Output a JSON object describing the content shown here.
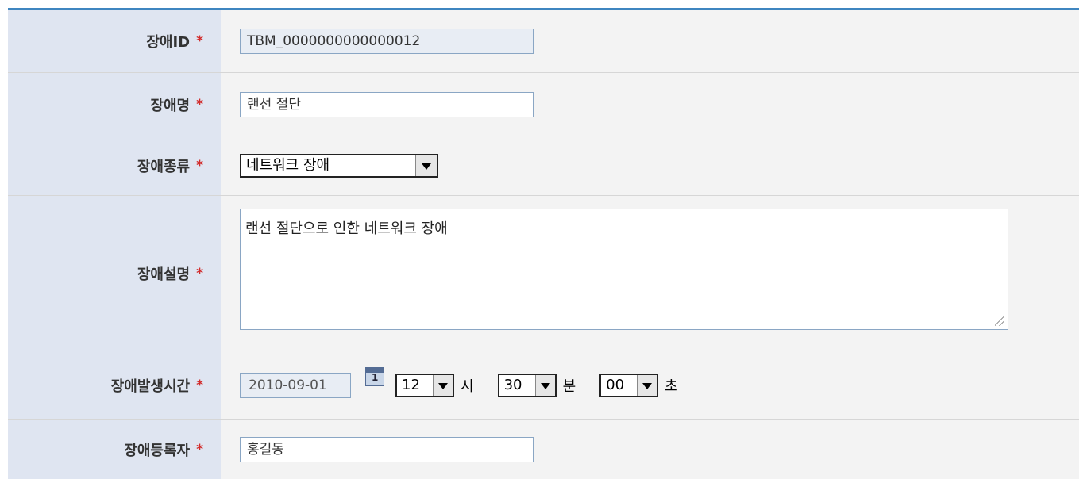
{
  "fields": {
    "id": {
      "label": "장애ID",
      "required": "*",
      "value": "TBM_0000000000000012"
    },
    "name": {
      "label": "장애명",
      "required": "*",
      "value": "랜선 절단"
    },
    "type": {
      "label": "장애종류",
      "required": "*",
      "selected": "네트워크 장애"
    },
    "description": {
      "label": "장애설명",
      "required": "*",
      "value": "랜선 절단으로 인한 네트워크 장애"
    },
    "time": {
      "label": "장애발생시간",
      "required": "*",
      "date": "2010-09-01",
      "calendar_icon": "calendar-icon",
      "hour": "12",
      "hour_unit": "시",
      "minute": "30",
      "minute_unit": "분",
      "second": "00",
      "second_unit": "초"
    },
    "registrant": {
      "label": "장애등록자",
      "required": "*",
      "value": "홍길동"
    }
  },
  "colors": {
    "accent": "#3f86c0",
    "label_bg": "#dfe5f1",
    "value_bg": "#f3f3f3",
    "required": "#d22c2c"
  }
}
